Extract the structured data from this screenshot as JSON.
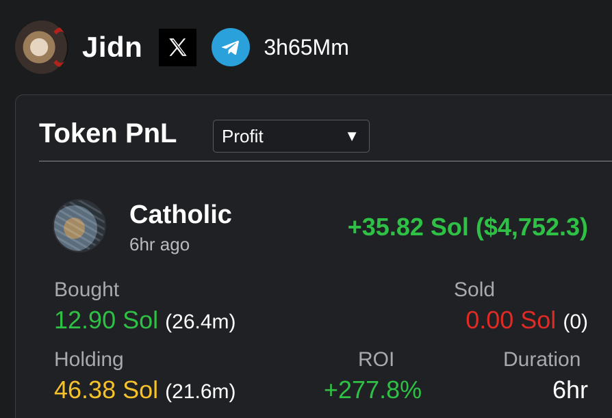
{
  "header": {
    "username": "Jidn",
    "handle": "3h65Mm",
    "x_icon": "x-logo-icon",
    "telegram_icon": "telegram-icon"
  },
  "card": {
    "title": "Token PnL",
    "dropdown": {
      "selected": "Profit",
      "caret": "▼"
    },
    "token": {
      "name": "Catholic",
      "time_ago": "6hr ago",
      "pnl": "+35.82 Sol ($4,752.3)"
    },
    "stats": {
      "bought_label": "Bought",
      "bought_value": "12.90 Sol",
      "bought_sub": "(26.4m)",
      "sold_label": "Sold",
      "sold_value": "0.00 Sol",
      "sold_sub": "(0)",
      "holding_label": "Holding",
      "holding_value": "46.38 Sol",
      "holding_sub": "(21.6m)",
      "roi_label": "ROI",
      "roi_value": "+277.8%",
      "duration_label": "Duration",
      "duration_value": "6hr"
    }
  },
  "colors": {
    "background": "#1b1c1e",
    "positive": "#2fc145",
    "negative": "#e02a24",
    "holding": "#f6c22a",
    "telegram": "#2aa1da"
  }
}
